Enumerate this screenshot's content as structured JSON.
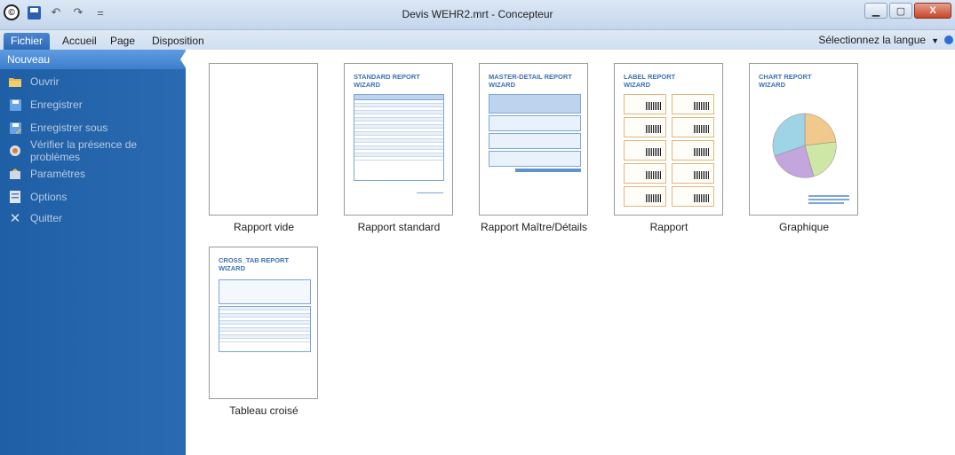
{
  "window": {
    "title": "Devis WEHR2.mrt - Concepteur",
    "controls": {
      "minimize_icon": "minimize-icon",
      "maximize_icon": "maximize-icon",
      "close_label": "X"
    }
  },
  "quick_access": {
    "undo_glyph": "↶",
    "redo_glyph": "↷",
    "customize_glyph": "="
  },
  "tabs": [
    {
      "label": "Fichier"
    },
    {
      "label": "Accueil"
    },
    {
      "label": "Page"
    },
    {
      "label": "Disposition"
    }
  ],
  "language": {
    "label": "Sélectionnez la langue"
  },
  "sidebar": {
    "items": [
      {
        "label": "Nouveau",
        "icon": "none"
      },
      {
        "label": "Ouvrir",
        "icon": "folder-icon"
      },
      {
        "label": "Enregistrer",
        "icon": "save-icon"
      },
      {
        "label": "Enregistrer sous",
        "icon": "save-as-icon"
      },
      {
        "label": "Vérifier la présence de problèmes",
        "icon": "check-issues-icon"
      },
      {
        "label": "Paramètres",
        "icon": "settings-icon"
      },
      {
        "label": "Options",
        "icon": "options-icon"
      },
      {
        "label": "Quitter",
        "icon": "close-icon"
      }
    ]
  },
  "templates": [
    {
      "label": "Rapport vide",
      "thumb_title": ""
    },
    {
      "label": "Rapport standard",
      "thumb_title": "STANDARD REPORT\nWIZARD"
    },
    {
      "label": "Rapport Maître/Détails",
      "thumb_title": "MASTER-DETAIL REPORT\nWIZARD"
    },
    {
      "label": "Rapport",
      "thumb_title": "LABEL REPORT\nWIZARD"
    },
    {
      "label": "Graphique",
      "thumb_title": "CHART REPORT\nWIZARD"
    },
    {
      "label": "Tableau croisé",
      "thumb_title": "CROSS_TAB REPORT\nWIZARD"
    }
  ],
  "colors": {
    "accent": "#2a6ab0",
    "sidebar_active": "#4a8bd6",
    "thumb_title": "#3f72b2"
  }
}
